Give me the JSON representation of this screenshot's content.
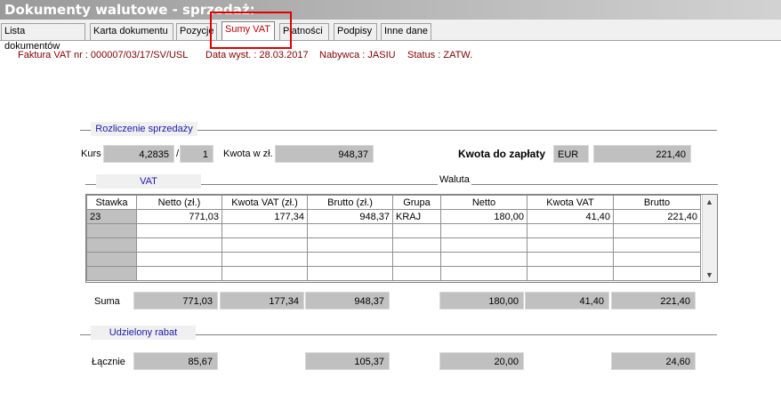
{
  "window": {
    "title": "Dokumenty walutowe - sprzedaż:"
  },
  "tabs": [
    {
      "label": "Lista dokumentów"
    },
    {
      "label": "Karta dokumentu"
    },
    {
      "label": "Pozycje"
    },
    {
      "label": "Sumy VAT",
      "active": true
    },
    {
      "label": "Płatności"
    },
    {
      "label": "Podpisy"
    },
    {
      "label": "Inne dane"
    }
  ],
  "info": {
    "faktura": "Faktura VAT nr : 000007/03/17/SV/USL",
    "data": "Data wyst. : 28.03.2017",
    "nabywca": "Nabywca : JASIU",
    "status": "Status : ZATW."
  },
  "rozliczenie": {
    "section_label": "Rozliczenie sprzedaży",
    "kurs_label": "Kurs",
    "kurs_value": "4,2835",
    "slash": "/",
    "kurs_unit": "1",
    "kwota_label": "Kwota w zł.",
    "kwota_value": "948,37",
    "do_zaplaty_label": "Kwota do zapłaty",
    "currency": "EUR",
    "do_zaplaty_value": "221,40"
  },
  "vat": {
    "section_label": "VAT",
    "waluta_label": "Waluta",
    "columns": [
      "Stawka",
      "Netto (zł.)",
      "Kwota VAT (zł.)",
      "Brutto (zł.)",
      "Grupa",
      "Netto",
      "Kwota VAT",
      "Brutto"
    ],
    "rows": [
      [
        "23",
        "771,03",
        "177,34",
        "948,37",
        "KRAJ",
        "180,00",
        "41,40",
        "221,40"
      ]
    ],
    "suma_label": "Suma",
    "suma": [
      "771,03",
      "177,34",
      "948,37",
      "180,00",
      "41,40",
      "221,40"
    ]
  },
  "rabat": {
    "section_label": "Udzielony rabat",
    "lacznie_label": "Łącznie",
    "values": [
      "85,67",
      "105,37",
      "20,00",
      "24,60"
    ]
  },
  "colors": {
    "accent_red": "#e00000",
    "section_blue": "#1a1aa8",
    "info_text": "#800000"
  }
}
